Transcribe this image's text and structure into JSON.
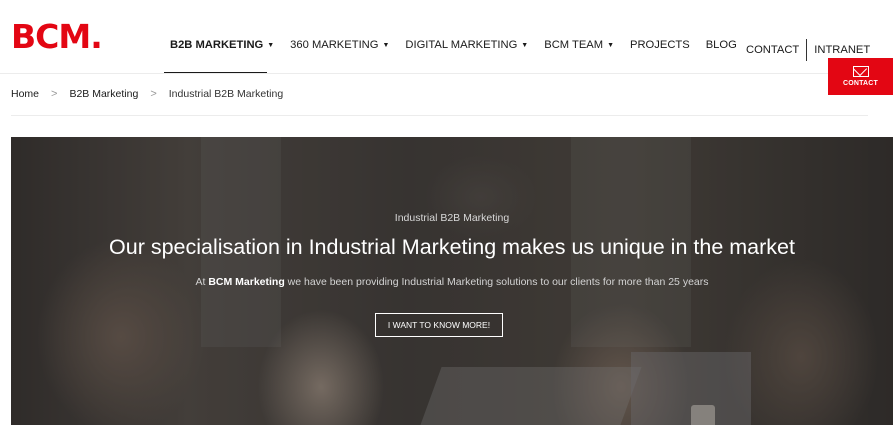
{
  "header": {
    "logo_text": "BCM.",
    "nav": [
      {
        "label": "B2B MARKETING",
        "has_caret": true,
        "active": true
      },
      {
        "label": "360 MARKETING",
        "has_caret": true
      },
      {
        "label": "DIGITAL MARKETING",
        "has_caret": true
      },
      {
        "label": "BCM TEAM",
        "has_caret": true
      },
      {
        "label": "PROJECTS",
        "has_caret": false
      },
      {
        "label": "BLOG",
        "has_caret": false
      }
    ],
    "right_links": {
      "contact": "CONTACT",
      "intranet": "INTRANET"
    },
    "contact_tab": {
      "label": "CONTACT",
      "icon": "mail-icon"
    }
  },
  "breadcrumb": {
    "items": [
      "Home",
      "B2B Marketing",
      "Industrial B2B Marketing"
    ],
    "separator": ">"
  },
  "hero": {
    "eyebrow": "Industrial B2B Marketing",
    "headline": "Our specialisation in Industrial Marketing makes us unique in the market",
    "subline_prefix": "At ",
    "subline_brand": "BCM Marketing",
    "subline_suffix": " we have been providing Industrial Marketing solutions to our clients for more than 25 years",
    "cta_label": "I WANT TO KNOW MORE!"
  },
  "colors": {
    "brand_red": "#e30613",
    "text_dark": "#1a1a1a"
  }
}
